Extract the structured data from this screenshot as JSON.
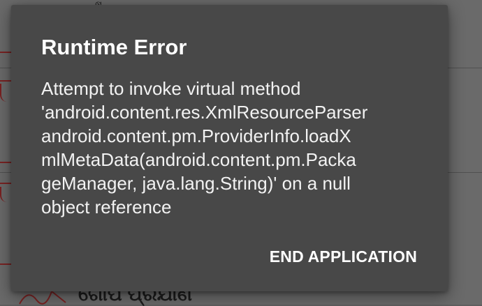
{
  "background_app": {
    "visible_heading": "ଗୋପ ପ୍ରଯାଣ",
    "top_glyph": "ଷ"
  },
  "dialog": {
    "title": "Runtime Error",
    "message": "Attempt to invoke virtual method\n'android.content.res.XmlResourceParser\nandroid.content.pm.ProviderInfo.loadX\nmlMetaData(android.content.pm.Packa\ngeManager, java.lang.String)' on a null\nobject reference",
    "button_label": "END APPLICATION"
  },
  "colors": {
    "dialog_background": "#484848",
    "scrim": "#5f5f5f",
    "text_primary": "#ffffff",
    "accent_marks": "#7a2222"
  }
}
